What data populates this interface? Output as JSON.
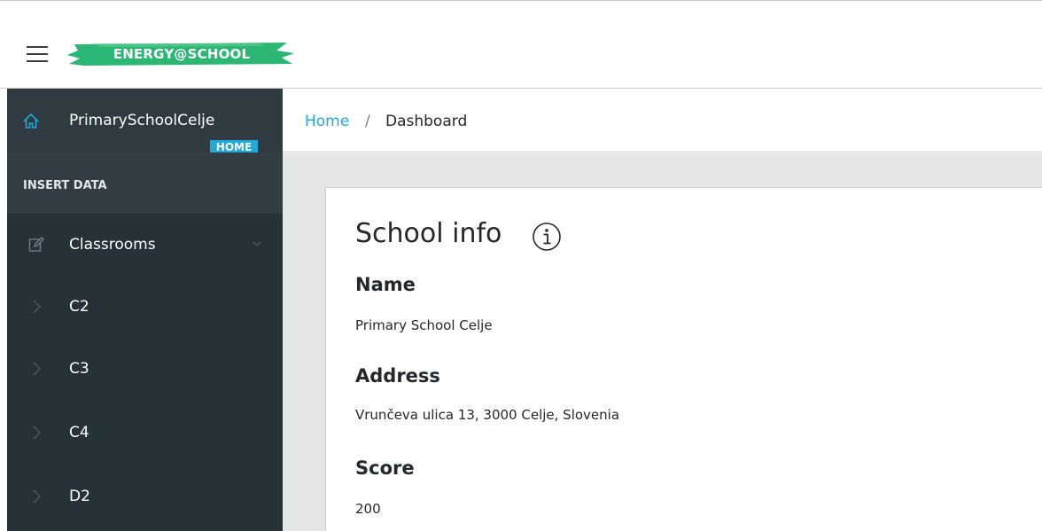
{
  "header": {
    "menu_icon": "hamburger-icon",
    "logo_text": "ENERGY@SCHOOL",
    "logo_color": "#2bb673"
  },
  "sidebar": {
    "school_name": "PrimarySchoolCelje",
    "school_icon": "home-icon",
    "home_badge": "HOME",
    "section_title": "INSERT DATA",
    "items": [
      {
        "label": "Classrooms",
        "icon": "edit-icon",
        "expanded": true
      },
      {
        "label": "C2",
        "icon": "chevron-right-icon"
      },
      {
        "label": "C3",
        "icon": "chevron-right-icon"
      },
      {
        "label": "C4",
        "icon": "chevron-right-icon"
      },
      {
        "label": "D2",
        "icon": "chevron-right-icon"
      }
    ]
  },
  "breadcrumb": {
    "home": "Home",
    "separator": "/",
    "current": "Dashboard"
  },
  "card": {
    "title": "School info",
    "info_icon": "info-icon",
    "fields": [
      {
        "label": "Name",
        "value": "Primary School Celje"
      },
      {
        "label": "Address",
        "value": "Vrunčeva ulica 13, 3000 Celje, Slovenia"
      },
      {
        "label": "Score",
        "value": "200"
      }
    ]
  },
  "colors": {
    "sidebar_bg": "#263238",
    "accent": "#20a8d8",
    "page_bg": "#e4e5e6"
  }
}
